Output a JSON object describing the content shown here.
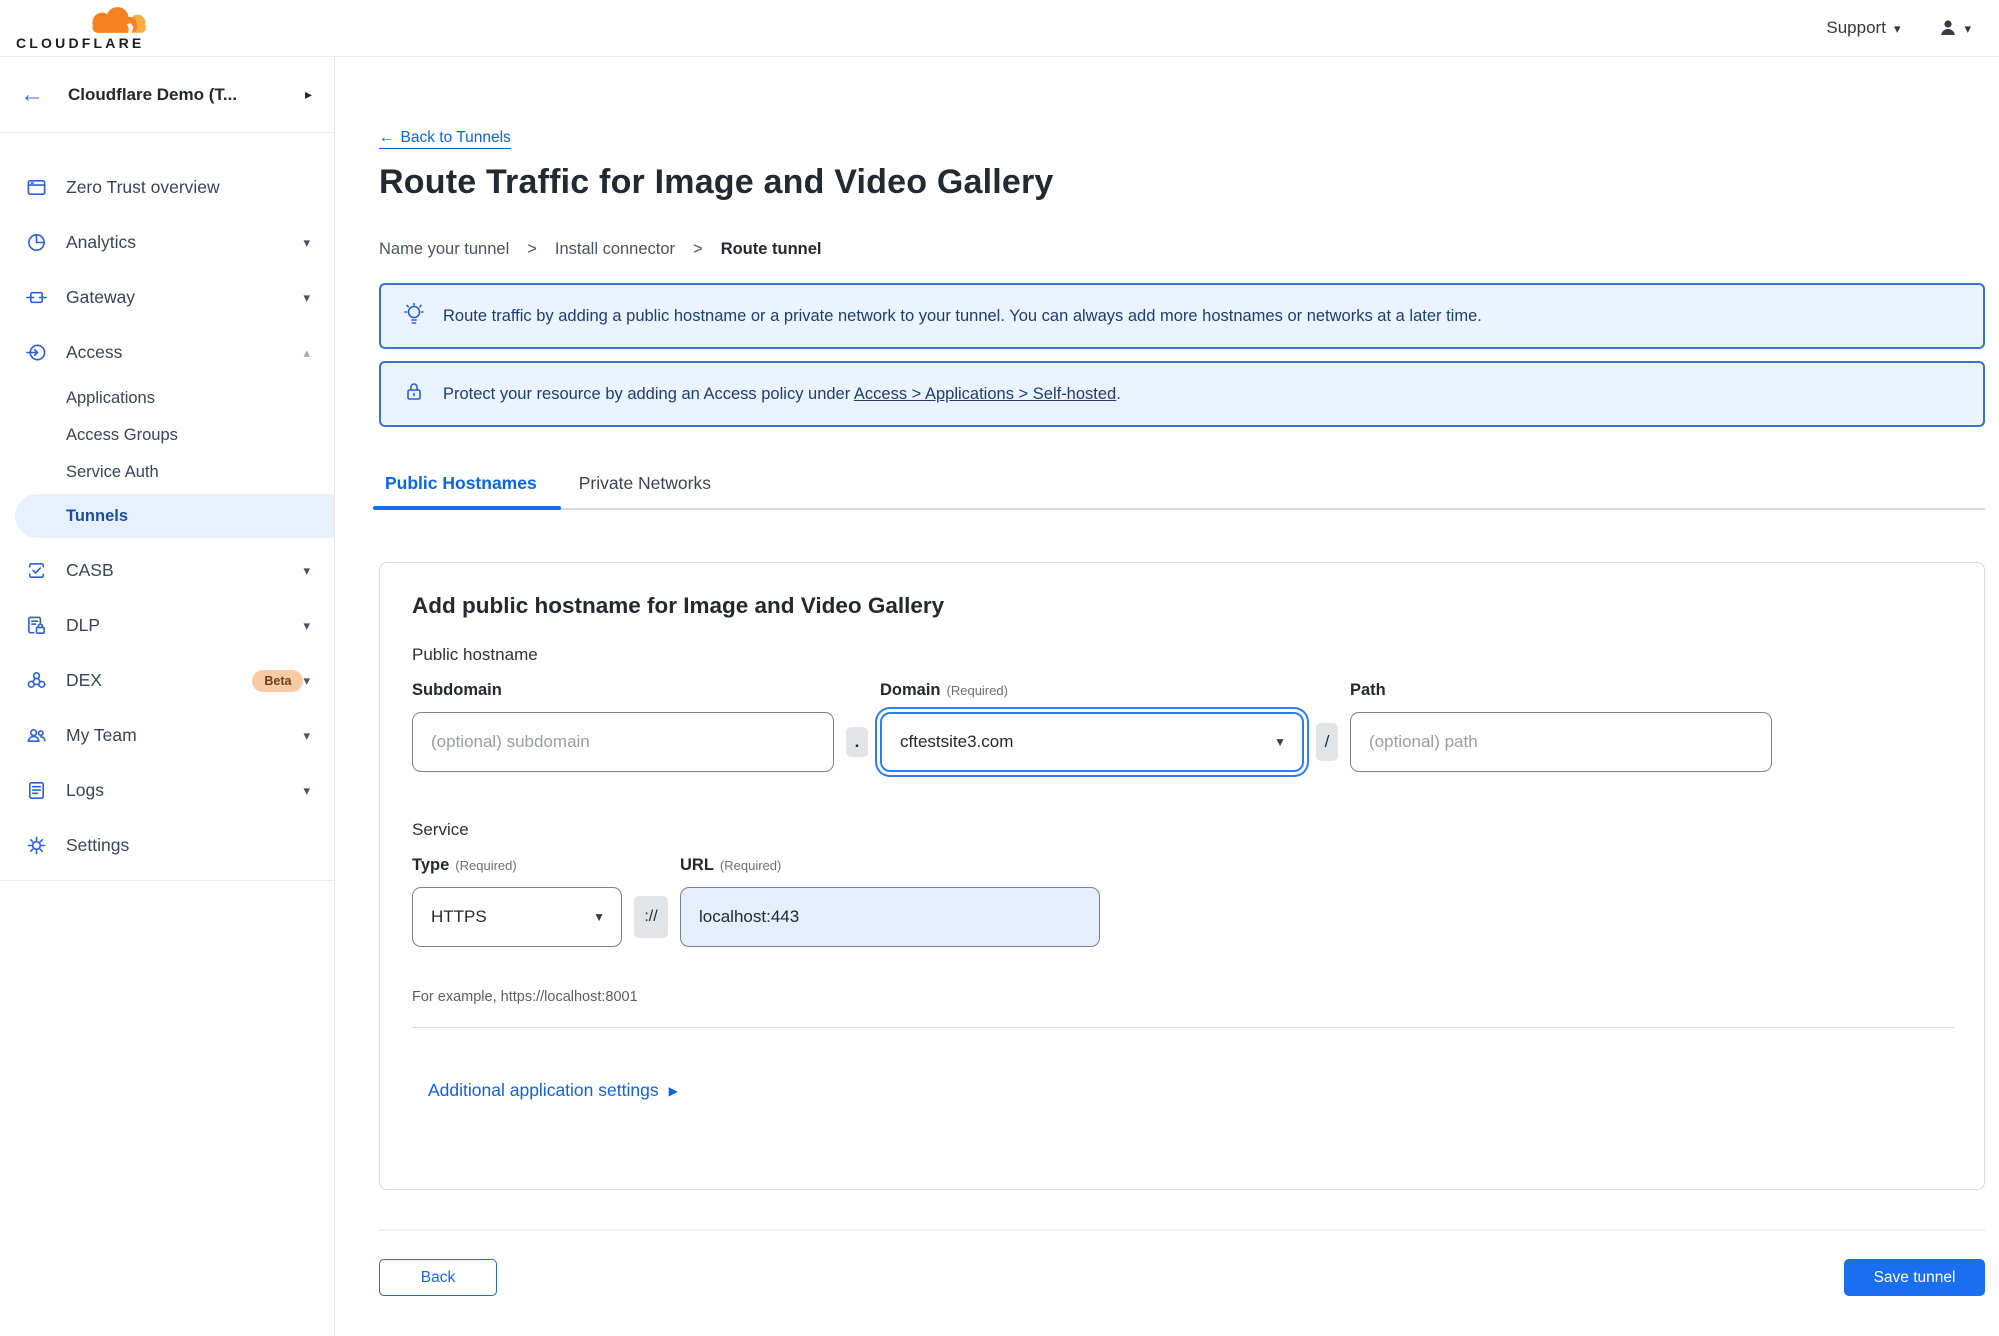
{
  "icons": {
    "chevron_down": "▾",
    "chevron_up": "▴",
    "chevron_right": "▸",
    "back_arrow": "←",
    "dropdown_caret": "▼",
    "disclosure_right": "▶",
    "step_separator": ">"
  },
  "colors": {
    "accent_blue": "#1a6ef0",
    "link_blue": "#0c63e4",
    "banner_bg": "#eaf3fe",
    "banner_border": "#3873c9",
    "sidebar_icon_blue": "#2e5fd7",
    "brand_orange": "#f6821f",
    "brand_orange_light": "#fbad41",
    "selected_pill_bg": "#e7f1fd",
    "beta_badge_bg": "#f8cba6"
  },
  "topnav": {
    "brand": "CLOUDFLARE",
    "support": "Support"
  },
  "sidebar": {
    "account": "Cloudflare Demo (T...",
    "overview": "Zero Trust overview",
    "analytics": "Analytics",
    "gateway": "Gateway",
    "access": "Access",
    "applications": "Applications",
    "access_groups": "Access Groups",
    "service_auth": "Service Auth",
    "tunnels": "Tunnels",
    "casb": "CASB",
    "dlp": "DLP",
    "dex": "DEX",
    "dex_badge": "Beta",
    "my_team": "My Team",
    "logs": "Logs",
    "settings": "Settings"
  },
  "page": {
    "back_link": "Back to Tunnels",
    "title": "Route Traffic for Image and Video Gallery",
    "steps": [
      "Name your tunnel",
      "Install connector",
      "Route tunnel"
    ],
    "banners": {
      "tip": "Route traffic by adding a public hostname or a private network to your tunnel. You can always add more hostnames or networks at a later time.",
      "protect_prefix": "Protect your resource by adding an Access policy under ",
      "protect_link": "Access > Applications > Self-hosted",
      "protect_suffix": "."
    },
    "tabs": {
      "public": "Public Hostnames",
      "private": "Private Networks"
    },
    "form": {
      "heading": "Add public hostname for Image and Video Gallery",
      "public_hostname_label": "Public hostname",
      "subdomain_label": "Subdomain",
      "subdomain_placeholder": "(optional) subdomain",
      "dot_separator": ".",
      "domain_label": "Domain",
      "required": "(Required)",
      "domain_value": "cftestsite3.com",
      "slash_separator": "/",
      "path_label": "Path",
      "path_placeholder": "(optional) path",
      "service_label": "Service",
      "type_label": "Type",
      "type_value": "HTTPS",
      "scheme_separator": "://",
      "url_label": "URL",
      "url_value": "localhost:443",
      "example": "For example, https://localhost:8001",
      "additional_settings": "Additional application settings"
    },
    "actions": {
      "back": "Back",
      "save": "Save tunnel"
    }
  }
}
